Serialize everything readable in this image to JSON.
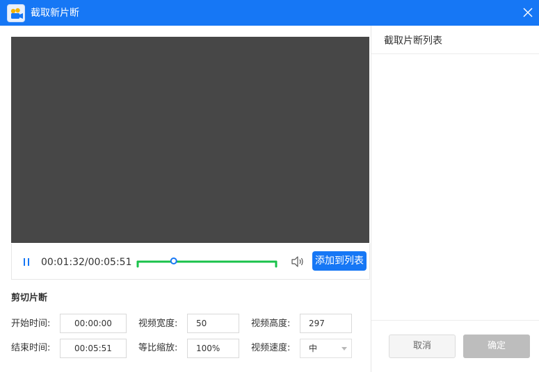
{
  "window": {
    "title": "截取新片断"
  },
  "player": {
    "timecode": "00:01:32/00:05:51",
    "progress_fraction": 0.26,
    "add_to_list_label": "添加到列表"
  },
  "clip": {
    "section_title": "剪切片断",
    "start_label": "开始时间:",
    "start_value": "00:00:00",
    "end_label": "结束时间:",
    "end_value": "00:05:51",
    "width_label": "视频宽度:",
    "width_value": "50",
    "scale_label": "等比缩放:",
    "scale_value": "100%",
    "height_label": "视频高度:",
    "height_value": "297",
    "speed_label": "视频速度:",
    "speed_value": "中"
  },
  "panel": {
    "title": "截取片断列表",
    "cancel_label": "取消",
    "ok_label": "确定"
  },
  "colors": {
    "accent": "#1677f5",
    "slider_green": "#19c24a",
    "video_bg": "#474747"
  }
}
